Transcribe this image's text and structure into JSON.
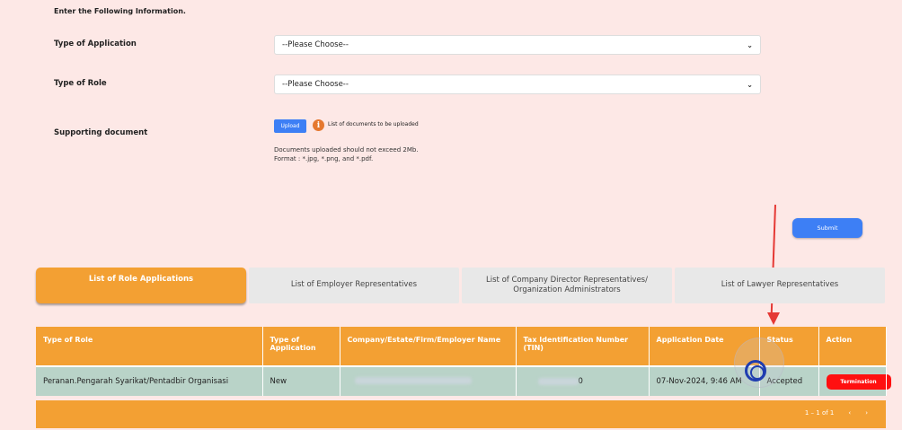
{
  "form": {
    "heading": "Enter the Following Information.",
    "application_label": "Type of Application",
    "application_value": "--Please Choose--",
    "role_label": "Type of Role",
    "role_value": "--Please Choose--",
    "document_label": "Supporting document",
    "upload_label": "Upload",
    "document_list_link": "List of documents to be uploaded",
    "note_line1": "Documents uploaded should not exceed 2Mb.",
    "note_line2": "Format : *.jpg, *.png, and *.pdf.",
    "submit_label": "Submit"
  },
  "tabs": [
    {
      "label": "List of Role Applications",
      "active": true
    },
    {
      "label": "List of Employer Representatives",
      "active": false
    },
    {
      "label": "List of Company Director Representatives/ Organization Administrators",
      "active": false
    },
    {
      "label": "List of Lawyer Representatives",
      "active": false
    }
  ],
  "table": {
    "columns": [
      "Type of Role",
      "Type of Application",
      "Company/Estate/Firm/Employer Name",
      "Tax Identification Number (TIN)",
      "Application Date",
      "Status",
      "Action"
    ],
    "rows": [
      {
        "role": "Peranan.Pengarah Syarikat/Pentadbir Organisasi",
        "application_type": "New",
        "tin_suffix": "0",
        "date": "07-Nov-2024, 9:46 AM",
        "status": "Accepted",
        "action": "Termination"
      }
    ]
  },
  "pagination": {
    "range": "1 – 1 of 1",
    "prev_icon": "chevron-left-icon",
    "next_icon": "chevron-right-icon"
  },
  "colors": {
    "background": "#fde8e6",
    "accent_orange": "#f3a033",
    "primary_blue": "#3d7ff5",
    "row_green": "#b9d3c8",
    "danger_red": "#ff1010",
    "annotation_red": "#e53935"
  }
}
